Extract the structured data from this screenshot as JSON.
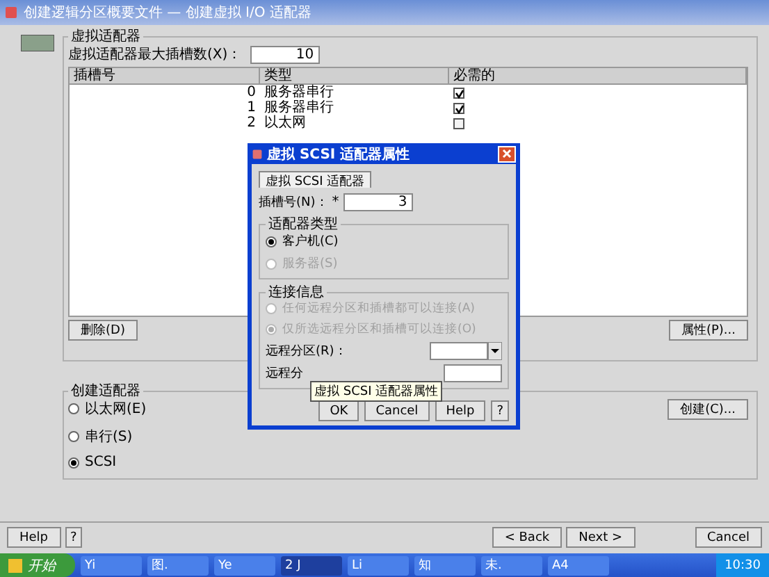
{
  "window": {
    "title": "创建逻辑分区概要文件 — 创建虚拟 I/O 适配器"
  },
  "adapters": {
    "title": "虚拟适配器",
    "max_slots_label": "虚拟适配器最大插槽数(X)：",
    "max_slots_value": "10",
    "columns": [
      "插槽号",
      "类型",
      "必需的"
    ],
    "rows": [
      {
        "slot": "0",
        "type": "服务器串行",
        "required": true
      },
      {
        "slot": "1",
        "type": "服务器串行",
        "required": true
      },
      {
        "slot": "2",
        "type": "以太网",
        "required": false
      }
    ],
    "delete_button": "删除(D)",
    "properties_button": "属性(P)..."
  },
  "create": {
    "title": "创建适配器",
    "options": [
      {
        "label": "以太网(E)",
        "selected": false
      },
      {
        "label": "串行(S)",
        "selected": false
      },
      {
        "label": "SCSI",
        "selected": true
      }
    ],
    "button": "创建(C)..."
  },
  "footer": {
    "help": "Help",
    "help_mark": "?",
    "back": "< Back",
    "next": "Next >",
    "cancel": "Cancel"
  },
  "dialog": {
    "title": "虚拟 SCSI 适配器属性",
    "tabs": [
      {
        "label": "虚拟 SCSI 适配器",
        "selected": true
      }
    ],
    "slot_label": "插槽号(N)：",
    "slot_required": "*",
    "slot_value": "3",
    "type_group": {
      "title": "适配器类型",
      "options": [
        {
          "label": "客户机(C)",
          "selected": true,
          "disabled": false
        },
        {
          "label": "服务器(S)",
          "selected": false,
          "disabled": true
        }
      ]
    },
    "connection_group": {
      "title": "连接信息",
      "options": [
        {
          "label": "任何远程分区和插槽都可以连接(A)",
          "selected": false,
          "disabled": true
        },
        {
          "label": "仅所选远程分区和插槽可以连接(O)",
          "selected": true,
          "disabled": true
        }
      ],
      "partition_label": "远程分区(R)：",
      "remote_slot_label": "远程分"
    },
    "buttons": [
      "OK",
      "Cancel",
      "Help"
    ],
    "help_mark": "?"
  },
  "tooltip": "虚拟 SCSI 适配器属性",
  "taskbar": {
    "start": "开始",
    "tasks": [
      {
        "label": "Yi",
        "active": false
      },
      {
        "label": "图.",
        "active": false
      },
      {
        "label": "Ye",
        "active": false
      },
      {
        "label": "2 J",
        "active": true
      },
      {
        "label": "Li",
        "active": false
      },
      {
        "label": "知",
        "active": false
      },
      {
        "label": "未.",
        "active": false
      },
      {
        "label": "A4",
        "active": false
      }
    ],
    "clock": "10:30"
  }
}
